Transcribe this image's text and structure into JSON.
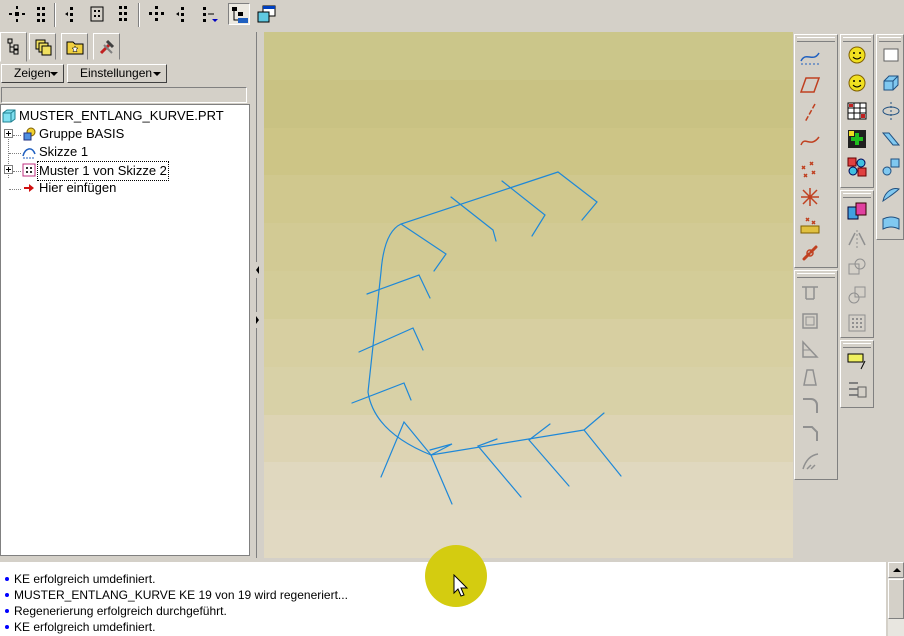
{
  "toolbar": {
    "icons": [
      "pattern-icon",
      "pattern-icon",
      "pattern-icon",
      "pattern-icon",
      "pattern-icon",
      "pattern-icon",
      "pattern-icon",
      "pattern-icon",
      "tree-layer-icon",
      "window-icon"
    ]
  },
  "model_tree": {
    "tabs": [
      "model-tree-tab",
      "layers-tab",
      "favorites-tab",
      "tools-tab"
    ],
    "show_menu": "Zeigen",
    "settings_menu": "Einstellungen",
    "items": [
      {
        "label": "MUSTER_ENTLANG_KURVE.PRT",
        "icon": "part-icon",
        "expandable": false
      },
      {
        "label": "Gruppe BASIS",
        "icon": "group-icon",
        "expandable": true
      },
      {
        "label": "Skizze 1",
        "icon": "sketch-icon",
        "expandable": false
      },
      {
        "label": "Muster 1 von Skizze 2",
        "icon": "pattern-feature-icon",
        "expandable": true,
        "focused": true
      },
      {
        "label": "Hier einfügen",
        "icon": "insert-arrow-icon",
        "expandable": false
      }
    ]
  },
  "graphics": {
    "background_bands": [
      "#cbc68a",
      "#c9c283",
      "#cdc586",
      "#d0c88e",
      "#d2ca94",
      "#d3cc98",
      "#d7cfa1",
      "#d8d1a7",
      "#ddd4b4",
      "#e0d8bf",
      "#e1d9c2"
    ],
    "curve_color": "#1e88d8"
  },
  "right_toolbar_datum": {
    "icons": [
      "datum-axis-icon",
      "datum-plane-icon",
      "datum-axis-line-icon",
      "datum-curve-icon",
      "datum-point-icon",
      "datum-csys-icon",
      "datum-analysis-icon",
      "chain-icon"
    ],
    "disabled_icons": [
      "hole-icon",
      "shell-icon",
      "rib-icon",
      "draft-icon",
      "round-icon",
      "chamfer-icon",
      "sweep-icon"
    ]
  },
  "right_toolbar_features": {
    "icons": [
      "smiley-icon",
      "smiley-icon",
      "table-icon",
      "add-feature-icon",
      "udf-icon",
      "copy-icon",
      "mirror-icon",
      "merge-icon",
      "trim-icon",
      "pattern-grid-icon",
      "note-icon",
      "layer-icon"
    ]
  },
  "right_toolbar_surfaces": {
    "icons": [
      "rectangle-icon",
      "extrude-icon",
      "revolve-icon",
      "sweep-tool-icon",
      "blend-icon",
      "boundary-icon",
      "surface-icon"
    ]
  },
  "messages": [
    "KE erfolgreich umdefiniert.",
    "MUSTER_ENTLANG_KURVE KE 19 von 19 wird regeneriert...",
    "Regenerierung erfolgreich durchgeführt.",
    "KE erfolgreich umdefiniert."
  ],
  "colors": {
    "chrome": "#d4d0c8",
    "bullet": "#0000ff",
    "cursor_highlight": "#d4cc10"
  }
}
